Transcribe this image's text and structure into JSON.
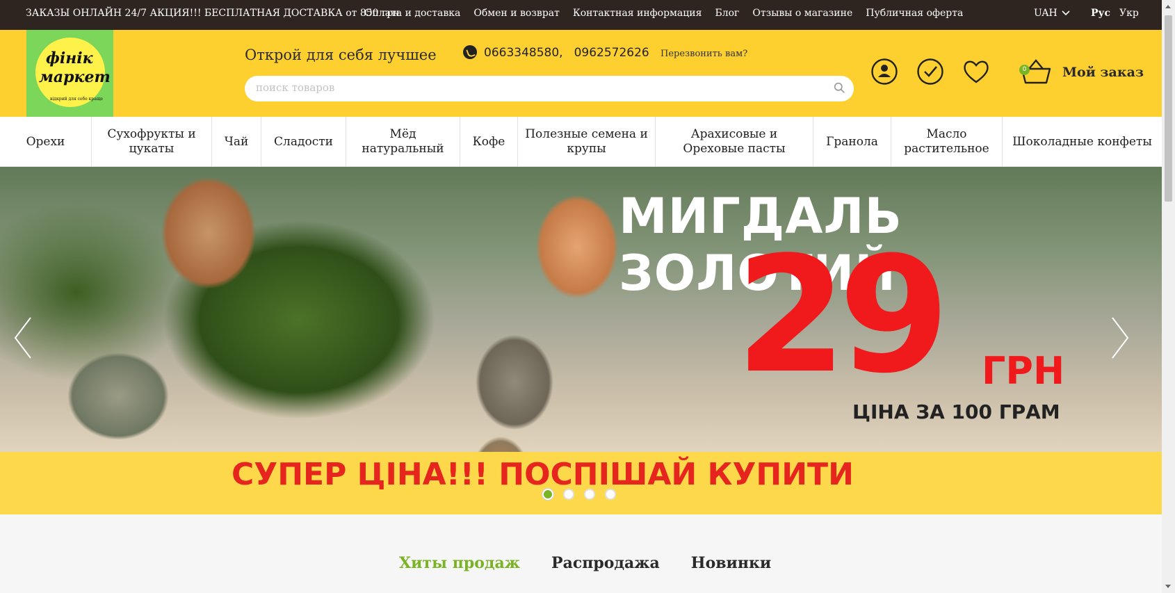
{
  "topbar": {
    "promo": "ЗАКАЗЫ ОНЛАЙН 24/7 АКЦИЯ!!! БЕСПЛАТНАЯ ДОСТАВКА от 850 грн",
    "links": [
      "Оплата и доставка",
      "Обмен и возврат",
      "Контактная информация",
      "Блог",
      "Отзывы о магазине",
      "Публичная оферта"
    ],
    "currency": "UAH",
    "lang_ru": "Рус",
    "lang_uk": "Укр"
  },
  "header": {
    "logo_line1": "фінік",
    "logo_line2": "маркет",
    "logo_line3": "відкрий для себе краще",
    "tagline": "Открой для себя лучшее",
    "phone1": "0663348580,",
    "phone2": "0962572626",
    "callback": "Перезвонить вам?",
    "search_placeholder": "поиск товаров",
    "cart_label": "Мой заказ",
    "cart_count": "0"
  },
  "nav": [
    "Орехи",
    "Сухофрукты и цукаты",
    "Чай",
    "Сладости",
    "Мёд натуральный",
    "Кофе",
    "Полезные семена и крупы",
    "Арахисовые и Ореховые пасты",
    "Гранола",
    "Масло растительное",
    "Шоколадные конфеты"
  ],
  "banner": {
    "title": "МИГДАЛЬ ЗОЛОТИЙ",
    "price": "29",
    "currency": "ГРН",
    "per": "ЦІНА ЗА 100 ГРАМ",
    "cta": "СУПЕР ЦІНА!!! ПОСПІШАЙ КУПИТИ",
    "slides": 4,
    "active_slide": 1
  },
  "tabs": [
    "Хиты продаж",
    "Распродажа",
    "Новинки"
  ],
  "colors": {
    "topbar_bg": "#2e2420",
    "header_bg": "#fdcf2f",
    "accent_green": "#7ab324",
    "price_red": "#f0191c"
  }
}
